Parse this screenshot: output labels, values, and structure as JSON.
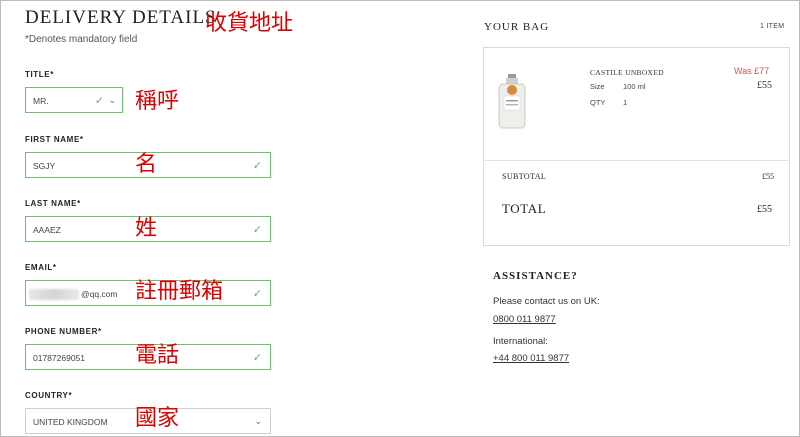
{
  "form": {
    "title": "DELIVERY DETAILS",
    "mandatory_note": "*Denotes mandatory field",
    "fields": {
      "title": {
        "label": "TITLE*",
        "value": "MR."
      },
      "first": {
        "label": "FIRST NAME*",
        "value": "SGJY"
      },
      "last": {
        "label": "LAST NAME*",
        "value": "AAAEZ"
      },
      "email": {
        "label": "EMAIL*",
        "value": "@qq.com"
      },
      "phone": {
        "label": "PHONE NUMBER*",
        "value": "01787269051"
      },
      "country": {
        "label": "COUNTRY*",
        "value": "UNITED KINGDOM"
      }
    }
  },
  "annotations": {
    "title_note": "收貨地址",
    "title_field": "稱呼",
    "first_name": "名",
    "last_name": "姓",
    "email": "註冊郵箱",
    "phone": "電話",
    "country": "國家"
  },
  "bag": {
    "title": "YOUR BAG",
    "count": "1 ITEM",
    "item": {
      "name": "CASTILE UNBOXED",
      "size_label": "Size",
      "size_value": "100 ml",
      "qty_label": "QTY",
      "qty_value": "1",
      "was_price": "Was £77",
      "price": "£55"
    },
    "subtotal_label": "SUBTOTAL",
    "subtotal_value": "£55",
    "total_label": "TOTAL",
    "total_value": "£55"
  },
  "assistance": {
    "title": "ASSISTANCE?",
    "uk_text": "Please contact us on UK:",
    "uk_phone": "0800 011 9877",
    "intl_text": "International:",
    "intl_phone": "+44 800 011 9877"
  },
  "colors": {
    "valid_border": "#6cc26c",
    "annotation": "#e00000",
    "was_price": "#d9534f"
  }
}
